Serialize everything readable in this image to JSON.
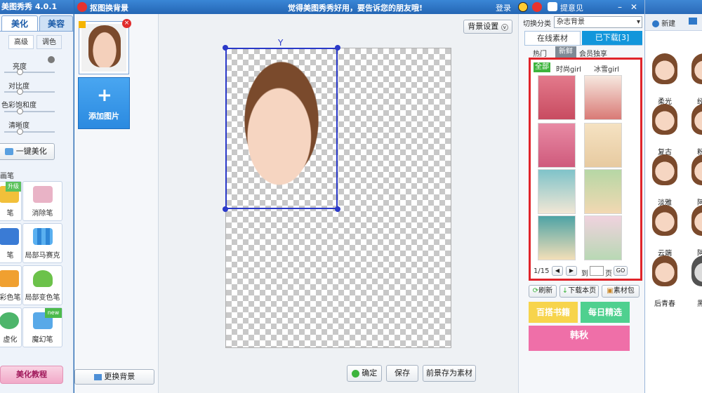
{
  "app": {
    "title": "美图秀秀 4.0.1",
    "tabs": [
      "美化",
      "美容"
    ],
    "subtabs": [
      "高级",
      "调色"
    ],
    "sliders": [
      "亮度",
      "对比度",
      "色彩饱和度",
      "清晰度"
    ],
    "one_click": "一键美化",
    "brush_section": "画笔",
    "brushes": [
      {
        "label": "笔",
        "badge": "升级",
        "icon": "brush-icon"
      },
      {
        "label": "消除笔",
        "badge": "",
        "icon": "eraser-icon"
      },
      {
        "label": "笔",
        "badge": "",
        "icon": "mosaic-pen-icon"
      },
      {
        "label": "局部马赛克",
        "badge": "",
        "icon": "mosaic-icon"
      },
      {
        "label": "彩色笔",
        "badge": "",
        "icon": "color-pen-icon"
      },
      {
        "label": "局部变色笔",
        "badge": "",
        "icon": "bucket-icon"
      },
      {
        "label": "虚化",
        "badge": "",
        "icon": "blur-icon"
      },
      {
        "label": "魔幻笔",
        "badge": "new",
        "icon": "magic-pen-icon"
      }
    ],
    "tutorial": "美化教程"
  },
  "dialog": {
    "title": "抠图换背景",
    "banner": "觉得美图秀秀好用，要告诉您的朋友哦!",
    "login": "登录",
    "feedback": "提意见",
    "add_image": "添加图片",
    "change_bg": "更换背景",
    "bg_settings": "背景设置",
    "confirm": "确定",
    "save": "保存",
    "save_fg": "前景存为素材"
  },
  "right": {
    "switch_label": "切换分类",
    "category": "杂志背景",
    "tab_online": "在线素材",
    "tab_downloaded": "已下载[3]",
    "subtabs": [
      "热门",
      "新鲜",
      "会员独享"
    ],
    "filters": [
      "全部",
      "时尚girl",
      "冰雪girl"
    ],
    "page": "1/15",
    "goto_label": "到",
    "page_suffix": "页",
    "go": "GO",
    "refresh": "刷新",
    "download_page": "下载本页",
    "package": "素材包",
    "promo1": "百搭书籍",
    "promo2": "每日精选",
    "promo3": "韩秋"
  },
  "farright": {
    "new_label": "新建",
    "open_label": "打开",
    "effects": [
      "柔光",
      "经典",
      "复古",
      "粉红",
      "淡雅",
      "阿宝",
      "云端",
      "阿宝",
      "后青春",
      "黑白"
    ]
  },
  "colors": {
    "accent": "#2b6fb6",
    "selection_border": "#e0242a",
    "tab_active": "#1296db",
    "promo_yellow": "#f7d44c",
    "promo_green": "#4fd08f",
    "promo_pink": "#ef6fa8"
  }
}
